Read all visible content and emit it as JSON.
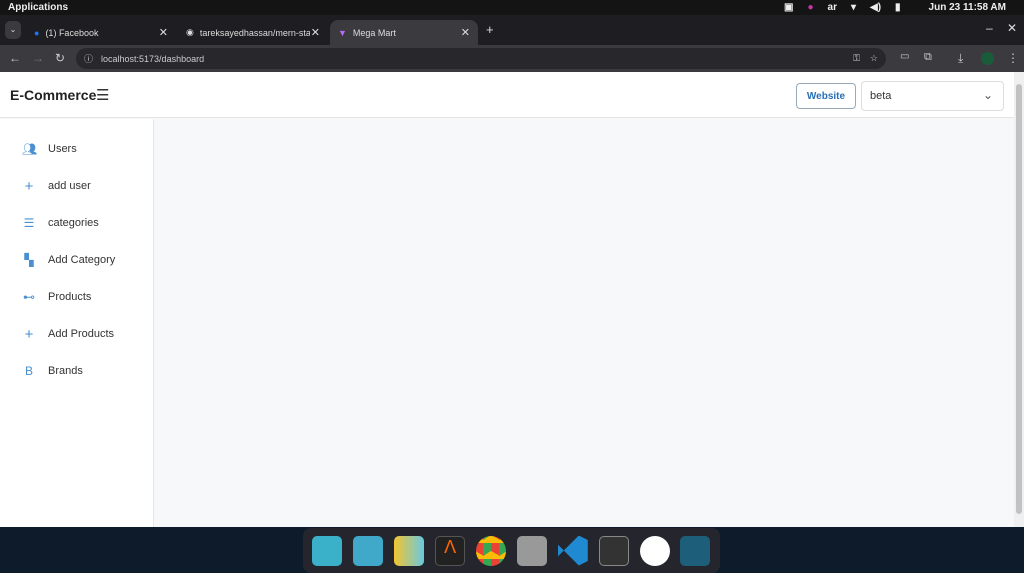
{
  "system": {
    "menu": "Applications",
    "keyboard": "ar",
    "datetime": "Jun 23  11:58 AM"
  },
  "browser": {
    "tabs": [
      {
        "label": "(1) Facebook"
      },
      {
        "label": "tareksayedhassan/mern-sta"
      },
      {
        "label": "Mega Mart"
      }
    ],
    "url": "localhost:5173/dashboard"
  },
  "header": {
    "brand": "E-Commerce",
    "website_label": "Website",
    "select_value": "beta"
  },
  "sidebar": {
    "items": [
      {
        "label": "Users",
        "icon": "users-icon"
      },
      {
        "label": "add user",
        "icon": "plus-icon"
      },
      {
        "label": "categories",
        "icon": "list-check-icon"
      },
      {
        "label": "Add Category",
        "icon": "category-add-icon"
      },
      {
        "label": "Products",
        "icon": "products-icon"
      },
      {
        "label": "Add Products",
        "icon": "plus-icon"
      },
      {
        "label": "Brands",
        "icon": "brand-b-icon"
      }
    ]
  },
  "dock": {
    "apps": [
      "search",
      "notes",
      "app-grid",
      "alacritty",
      "chrome",
      "files",
      "vscode",
      "terminal",
      "whatsapp",
      "panel"
    ]
  }
}
